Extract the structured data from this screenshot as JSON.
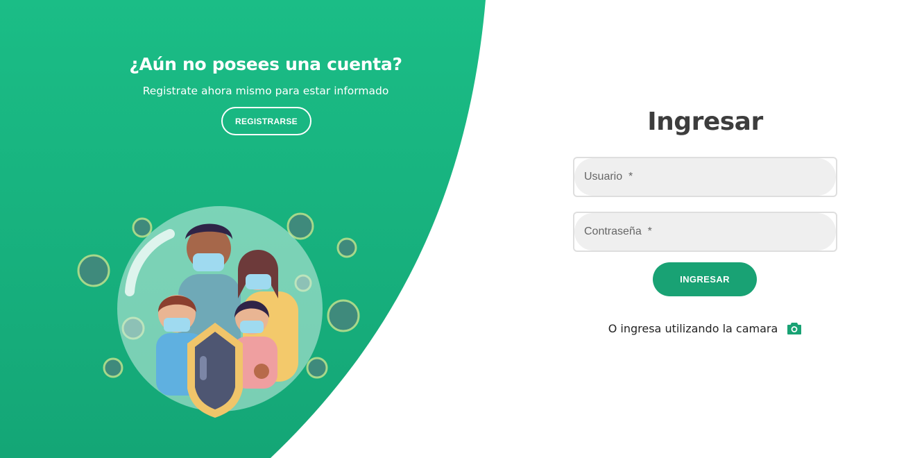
{
  "signup": {
    "title": "¿Aún no posees una cuenta?",
    "subtitle": "Registrate ahora mismo para estar informado",
    "button_label": "REGISTRARSE"
  },
  "login": {
    "title": "Ingresar",
    "username_placeholder": "Usuario  *",
    "password_placeholder": "Contraseña  *",
    "button_label": "INGRESAR",
    "camera_text": "O ingresa utilizando la camara",
    "camera_icon": "camera-icon"
  },
  "colors": {
    "brand_green": "#19a274",
    "brand_green_light": "#1bbd86",
    "title_dark": "#3d3d3d"
  },
  "illustration": {
    "subject": "family-wearing-masks-in-protective-bubble-icon"
  }
}
